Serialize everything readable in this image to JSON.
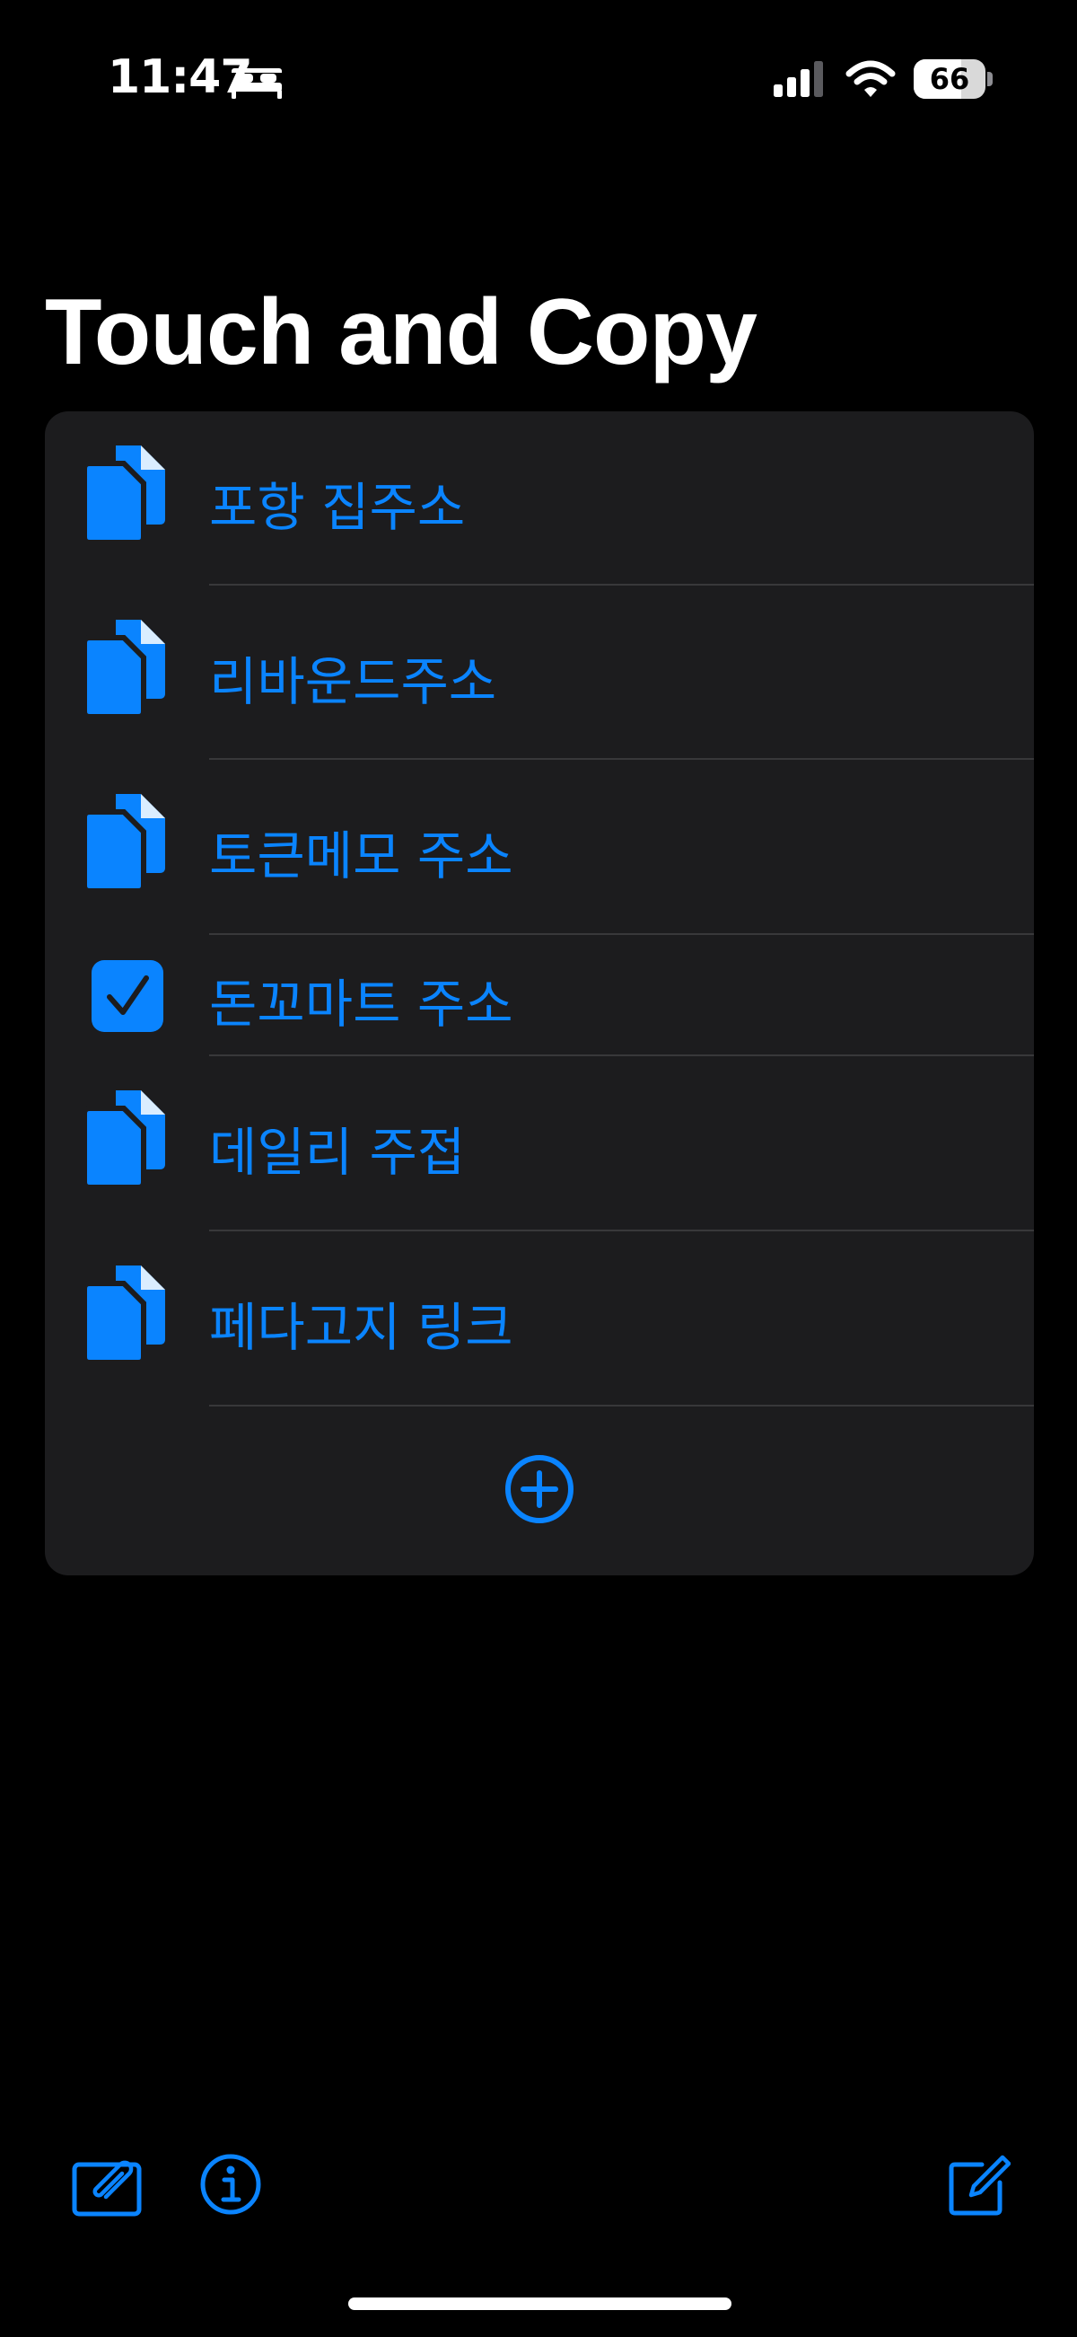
{
  "status_bar": {
    "time": "11:47",
    "focus_icon": "bed-icon",
    "battery_percent": "66",
    "battery_level": 0.66
  },
  "page": {
    "title": "Touch and Copy"
  },
  "list": {
    "items": [
      {
        "label": "포항 집주소",
        "icon": "document-copy-icon",
        "copied": false
      },
      {
        "label": "리바운드주소",
        "icon": "document-copy-icon",
        "copied": false
      },
      {
        "label": "토큰메모 주소",
        "icon": "document-copy-icon",
        "copied": false
      },
      {
        "label": "돈꼬마트 주소",
        "icon": "checkmark-square-icon",
        "copied": true
      },
      {
        "label": "데일리 주접",
        "icon": "document-copy-icon",
        "copied": false
      },
      {
        "label": "페다고지 링크",
        "icon": "document-copy-icon",
        "copied": false
      }
    ],
    "add_icon": "plus-circle-icon"
  },
  "toolbar": {
    "left_icons": [
      "attachment-note-icon",
      "info-icon"
    ],
    "right_icon": "compose-icon"
  },
  "colors": {
    "background": "#000000",
    "card": "#1c1c1e",
    "separator": "#38383a",
    "accent": "#0a84ff",
    "text": "#ffffff"
  }
}
